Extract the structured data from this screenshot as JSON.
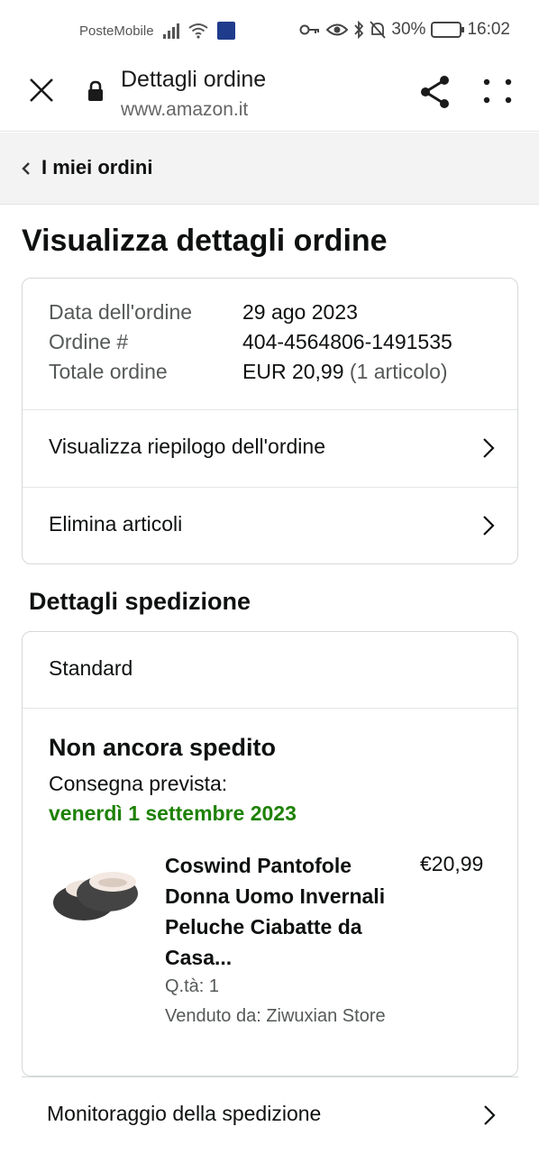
{
  "status_bar": {
    "carrier": "PosteMobile",
    "battery": "30%",
    "time": "16:02"
  },
  "browser": {
    "title": "Dettagli ordine",
    "url": "www.amazon.it"
  },
  "breadcrumb": {
    "label": "I miei ordini"
  },
  "page": {
    "title": "Visualizza dettagli ordine"
  },
  "order_info": {
    "rows": [
      {
        "label": "Data dell'ordine",
        "value": "29 ago 2023",
        "extra": ""
      },
      {
        "label": "Ordine #",
        "value": "404-4564806-1491535",
        "extra": ""
      },
      {
        "label": "Totale ordine",
        "value": "EUR 20,99",
        "extra": "(1 articolo)"
      }
    ],
    "links": [
      {
        "label": "Visualizza riepilogo dell'ordine"
      },
      {
        "label": "Elimina articoli"
      }
    ]
  },
  "shipping": {
    "section_title": "Dettagli spedizione",
    "method": "Standard",
    "status": "Non ancora spedito",
    "expected_label": "Consegna prevista:",
    "expected_date": "venerdì 1 settembre 2023",
    "date_color": "#1d8102",
    "product": {
      "title": "Coswind Pantofole Donna Uomo Invernali Peluche Ciabatte da Casa...",
      "price": "€20,99",
      "quantity": "Q.tà: 1",
      "seller": "Venduto da: Ziwuxian Store",
      "image_icon": "slippers-image"
    }
  },
  "tracking": {
    "label": "Monitoraggio della spedizione"
  }
}
